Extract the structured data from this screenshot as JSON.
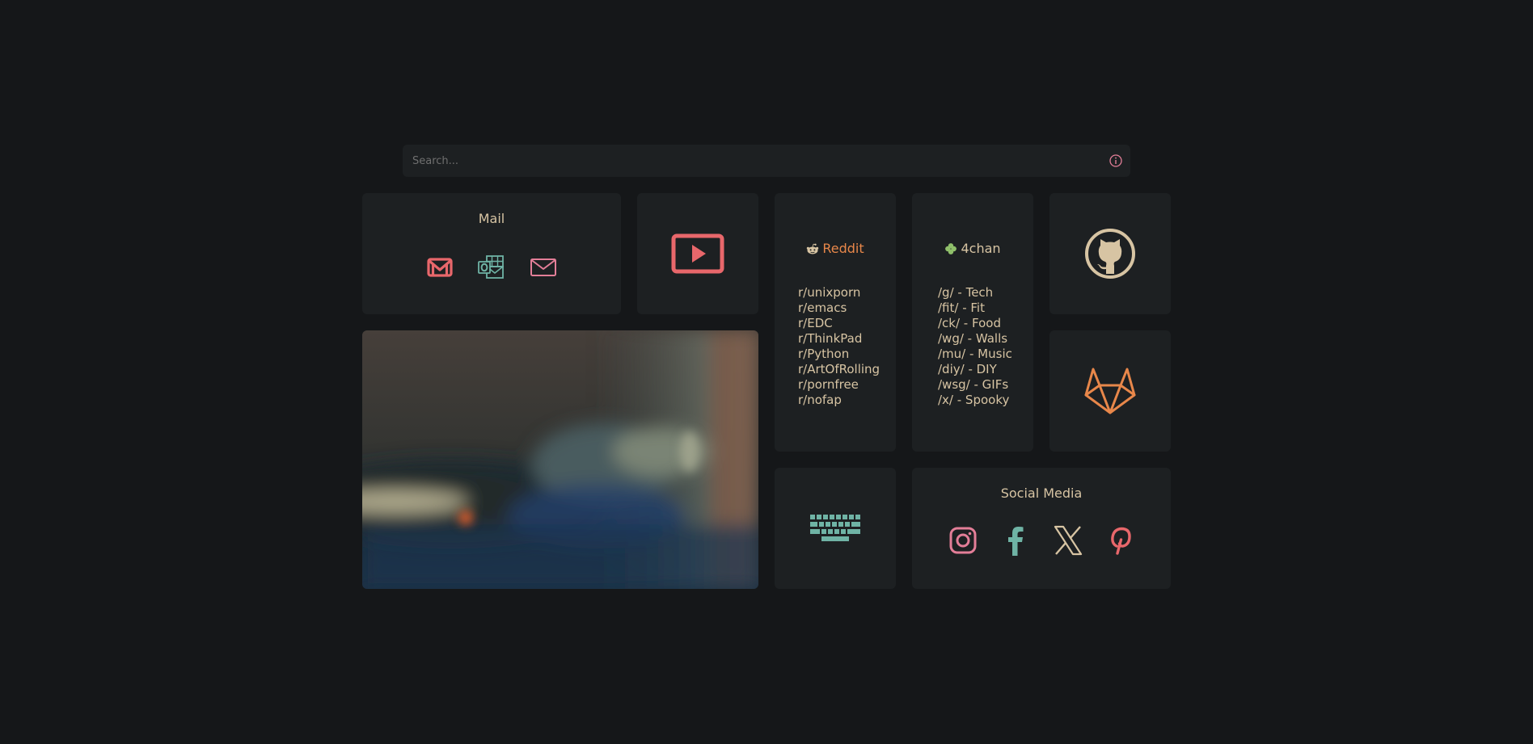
{
  "search": {
    "placeholder": "Search..."
  },
  "mail": {
    "title": "Mail",
    "icons": [
      "gmail-icon",
      "outlook-icon",
      "envelope-icon"
    ]
  },
  "youtube": {
    "icon": "youtube-play-icon"
  },
  "reddit": {
    "title": "Reddit",
    "color": "#e8874a",
    "links": [
      "r/unixporn",
      "r/emacs",
      "r/EDC",
      "r/ThinkPad",
      "r/Python",
      "r/ArtOfRolling",
      "r/pornfree",
      "r/nofap"
    ]
  },
  "fourchan": {
    "title": "4chan",
    "color": "#8fbf6a",
    "links": [
      "/g/ - Tech",
      "/fit/ - Fit",
      "/ck/ - Food",
      "/wg/ - Walls",
      "/mu/ - Music",
      "/diy/ - DIY",
      "/wsg/ - GIFs",
      "/x/ - Spooky"
    ]
  },
  "github": {
    "icon": "github-icon"
  },
  "gitlab": {
    "icon": "gitlab-icon"
  },
  "keyboard": {
    "icon": "keyboard-icon"
  },
  "social": {
    "title": "Social Media",
    "icons": [
      "instagram-icon",
      "facebook-icon",
      "x-icon",
      "pinterest-icon"
    ]
  },
  "colors": {
    "background": "#151719",
    "card": "#1d2022",
    "text": "#d7c4a3",
    "red": "#e8676b",
    "teal": "#6fb3a5",
    "pink": "#e37e98",
    "orange": "#e8874a",
    "tan": "#d7c4a3"
  }
}
